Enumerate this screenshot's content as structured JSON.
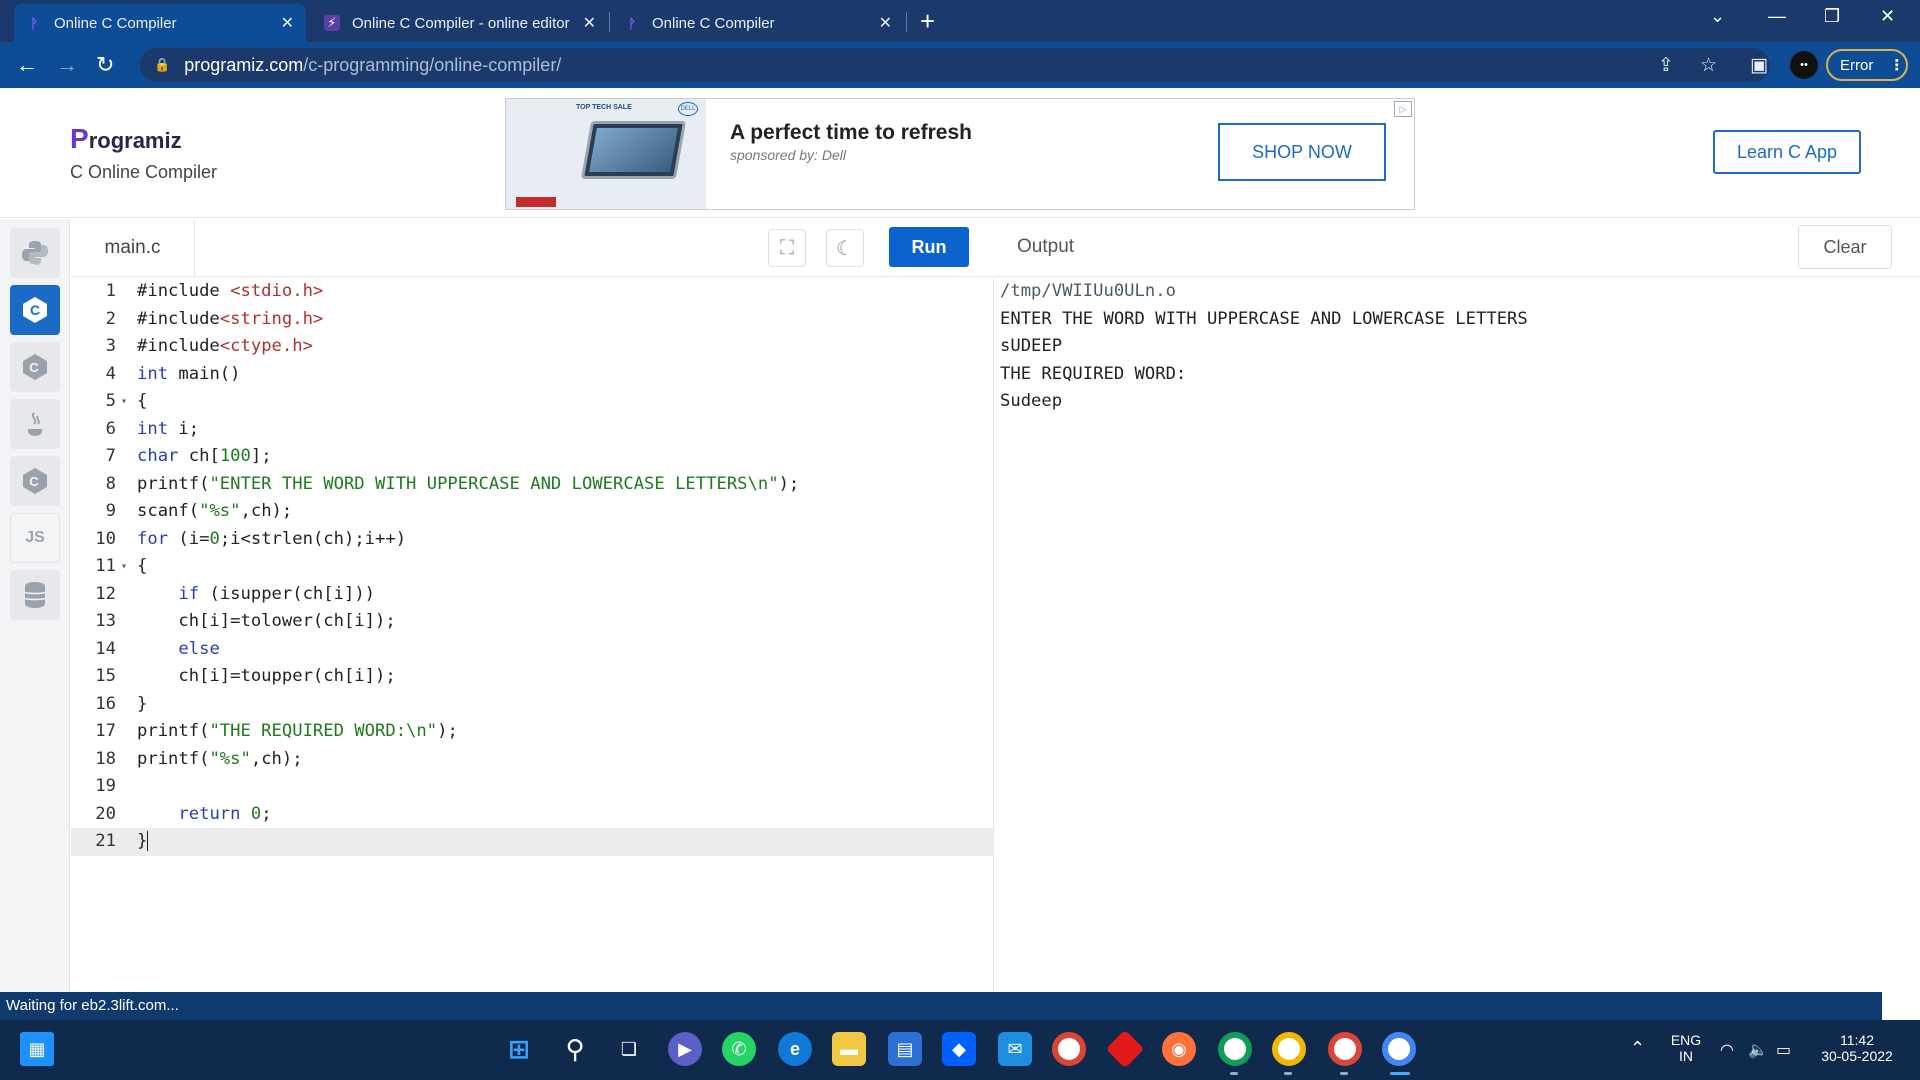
{
  "browser": {
    "tabs": [
      {
        "title": "Online C Compiler",
        "active": true
      },
      {
        "title": "Online C Compiler - online editor",
        "active": false
      },
      {
        "title": "Online C Compiler",
        "active": false
      }
    ],
    "url_host": "programiz.com",
    "url_path": "/c-programming/online-compiler/",
    "error_label": "Error"
  },
  "header": {
    "logo": "Programiz",
    "logo_first": "P",
    "logo_rest": "rogramiz",
    "subtitle": "C Online Compiler",
    "learn_button": "Learn C App"
  },
  "ad": {
    "title": "A perfect time to refresh",
    "sponsor": "sponsored by: Dell",
    "cta": "SHOP NOW",
    "img_badge": "TOP TECH SALE",
    "img_brand": "DELL"
  },
  "rail": {
    "items": [
      "python",
      "c",
      "cpp",
      "java",
      "csharp",
      "JS",
      "sql"
    ],
    "js_label": "JS"
  },
  "editor": {
    "filename": "main.c",
    "run_label": "Run",
    "lines": [
      "1",
      "2",
      "3",
      "4",
      "5",
      "6",
      "7",
      "8",
      "9",
      "10",
      "11",
      "12",
      "13",
      "14",
      "15",
      "16",
      "17",
      "18",
      "19",
      "20",
      "21"
    ]
  },
  "output": {
    "label": "Output",
    "clear_label": "Clear",
    "lines": [
      "/tmp/VWIIUu0ULn.o",
      "ENTER THE WORD WITH UPPERCASE AND LOWERCASE LETTERS",
      "sUDEEP",
      "THE REQUIRED WORD:",
      "Sudeep"
    ]
  },
  "status": {
    "text": "Waiting for eb2.3lift.com..."
  },
  "taskbar": {
    "lang": "ENG",
    "region": "IN",
    "time": "11:42",
    "date": "30-05-2022"
  }
}
